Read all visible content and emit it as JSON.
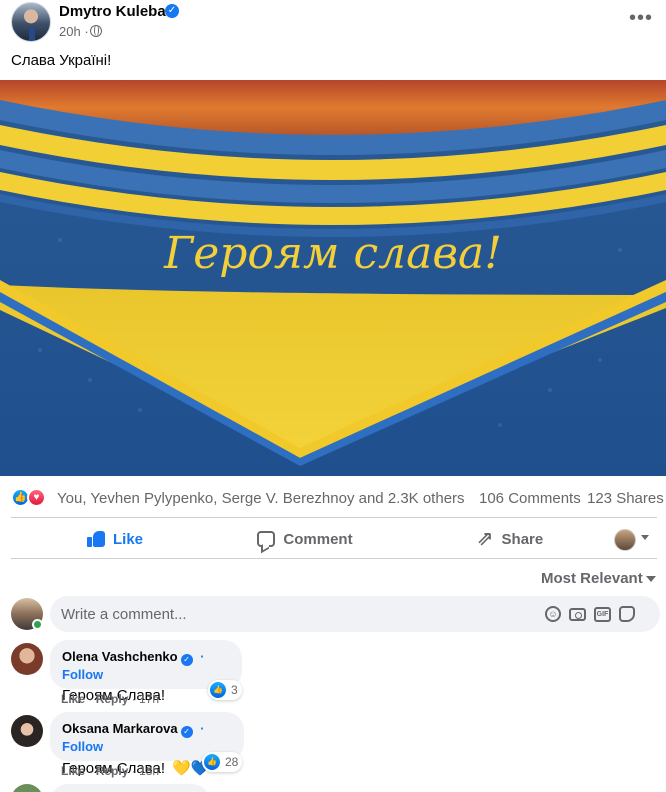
{
  "post": {
    "author": "Dmytro Kuleba",
    "time": "20h",
    "time_separator": "·",
    "text": "Слава Україні!",
    "image_caption_text": "Героям слава!"
  },
  "reactions": {
    "names": "You, Yevhen Pylypenko, Serge V. Berezhnoy and 2.3K others",
    "comments": "106 Comments",
    "shares": "123 Shares"
  },
  "actions": {
    "like": "Like",
    "comment": "Comment",
    "share": "Share"
  },
  "sort": {
    "label": "Most Relevant"
  },
  "composer": {
    "placeholder": "Write a comment..."
  },
  "comments": [
    {
      "name": "Olena Vashchenko",
      "follow": "Follow",
      "text": "Героям Слава!",
      "reaction_count": "3",
      "like_label": "Like",
      "reply_label": "Reply",
      "time": "17h"
    },
    {
      "name": "Oksana Markarova",
      "follow": "Follow",
      "text": "Героям Слава!",
      "emoji": "💛💙",
      "reaction_count": "28",
      "like_label": "Like",
      "reply_label": "Reply",
      "time": "18h"
    }
  ],
  "colors": {
    "accent": "#1877f2",
    "secondary_text": "#65676b",
    "bubble_bg": "#f0f2f5",
    "jersey_blue": "#2d5f99",
    "jersey_yellow": "#f2c92b"
  },
  "icons": {
    "verified": "verified-badge-icon",
    "globe": "globe-icon",
    "more": "more-options-icon",
    "like": "thumbs-up-icon",
    "love": "heart-icon",
    "comment": "comment-bubble-icon",
    "share": "share-arrow-icon"
  }
}
